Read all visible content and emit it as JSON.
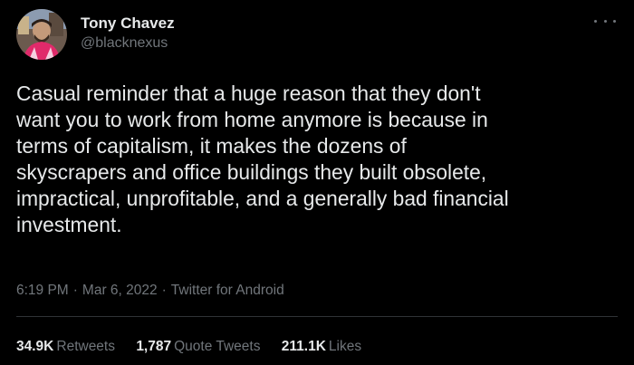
{
  "author": {
    "display_name": "Tony Chavez",
    "handle": "@blacknexus",
    "avatar_icon": "profile-photo"
  },
  "tweet": {
    "text": "Casual reminder that a huge reason that they don't\nwant you to work from home anymore is because in\nterms of capitalism, it makes the dozens of\nskyscrapers and office buildings they built obsolete,\nimpractical, unprofitable, and a generally bad financial\ninvestment.",
    "time": "6:19 PM",
    "date": "Mar 6, 2022",
    "source": "Twitter for Android",
    "separator": "·"
  },
  "stats": {
    "retweets_count": "34.9K",
    "retweets_label": "Retweets",
    "quotes_count": "1,787",
    "quotes_label": "Quote Tweets",
    "likes_count": "211.1K",
    "likes_label": "Likes"
  },
  "colors": {
    "background": "#000000",
    "primary_text": "#e7e9ea",
    "secondary_text": "#71767b",
    "divider": "#2f3336"
  },
  "icons": {
    "more": "more-horizontal-icon"
  }
}
